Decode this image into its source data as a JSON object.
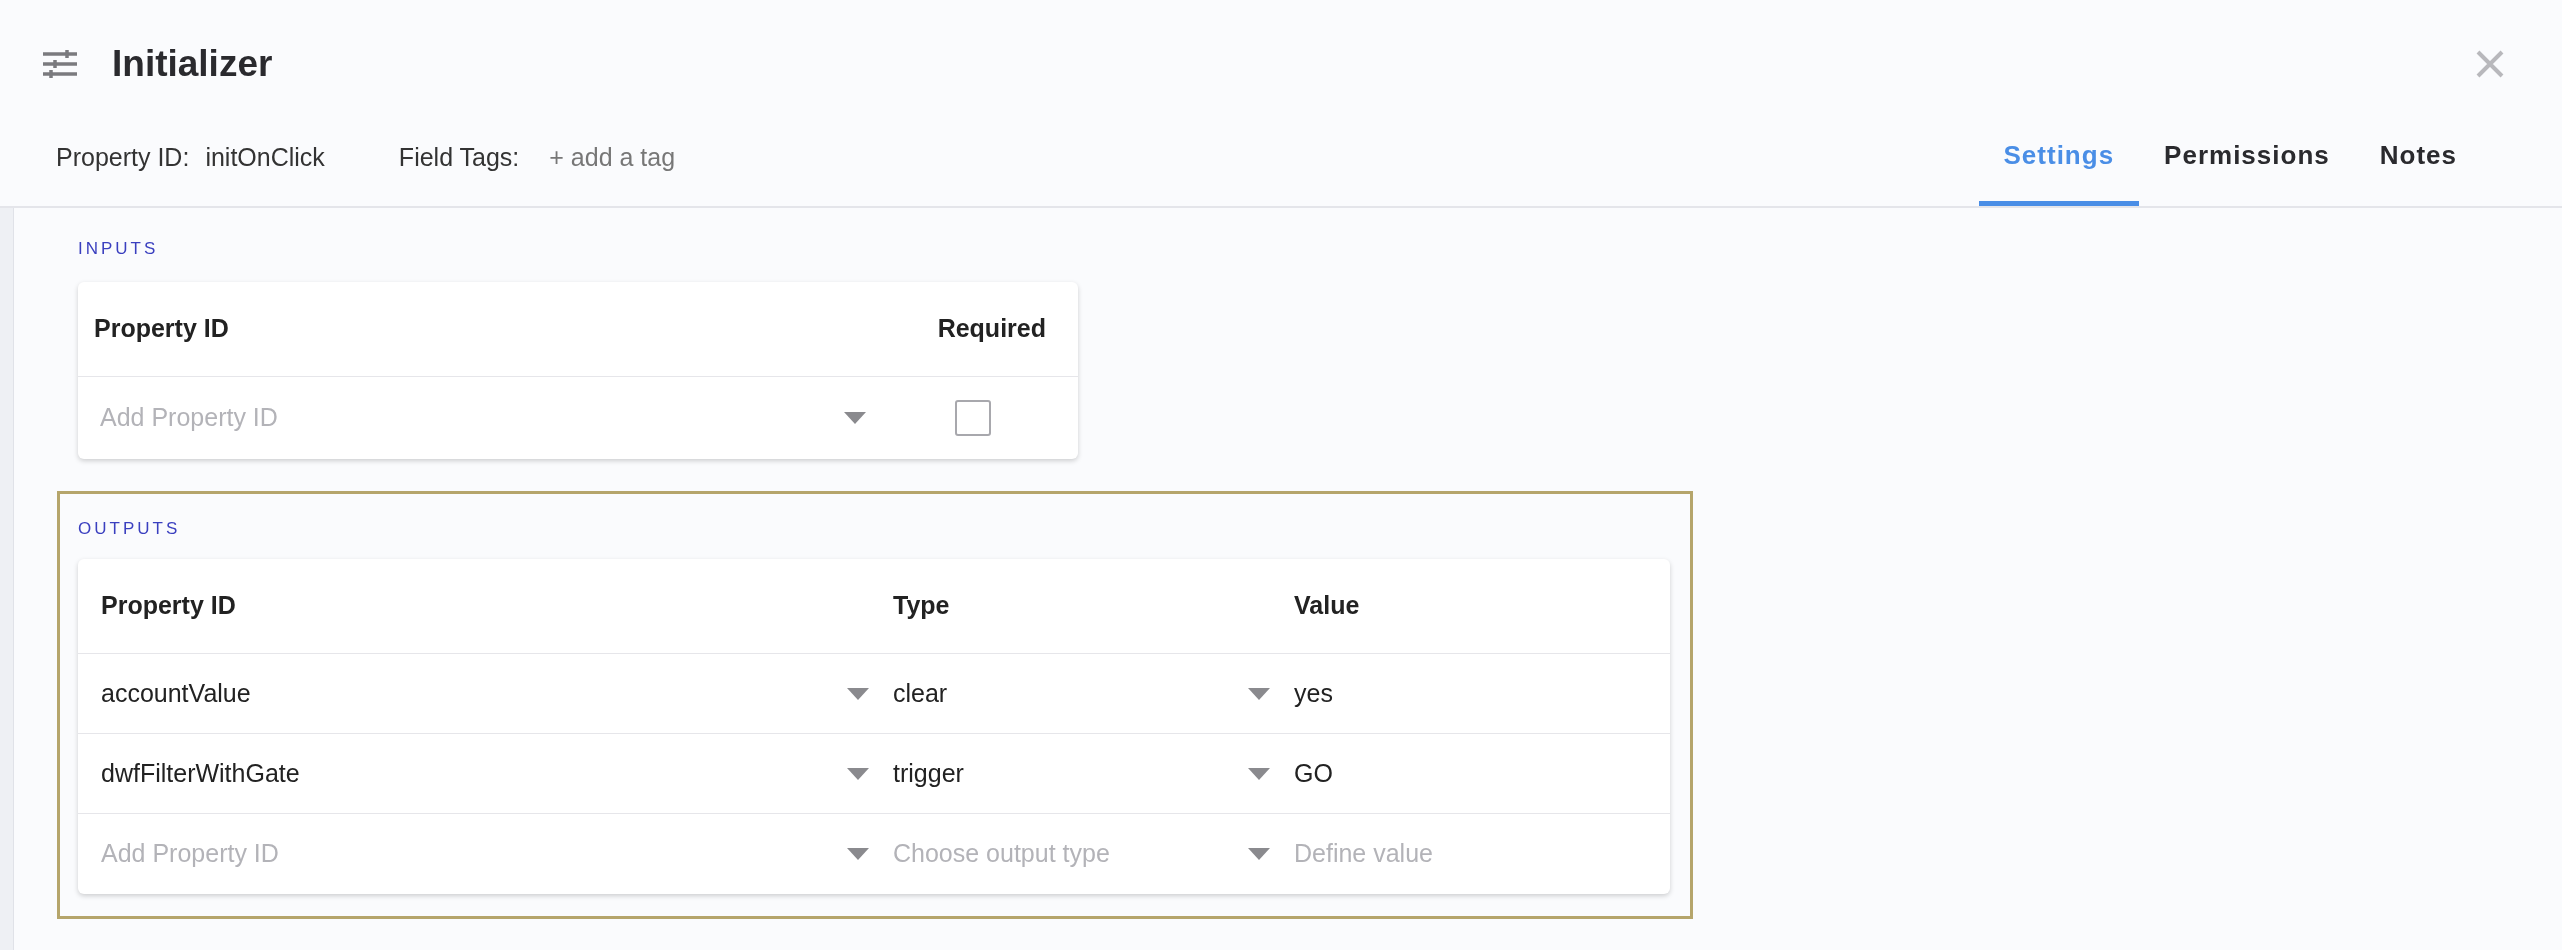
{
  "header": {
    "title": "Initializer",
    "property_id_label": "Property ID:",
    "property_id_value": "initOnClick",
    "field_tags_label": "Field Tags:",
    "add_tag": "+ add a tag"
  },
  "tabs": [
    {
      "label": "Settings",
      "selected": true
    },
    {
      "label": "Permissions",
      "selected": false
    },
    {
      "label": "Notes",
      "selected": false
    }
  ],
  "inputs": {
    "label": "INPUTS",
    "columns": [
      "Property ID",
      "Required"
    ],
    "rows": [
      {
        "property_id": {
          "placeholder": "Add Property ID"
        },
        "required": {
          "checked": false
        }
      }
    ]
  },
  "outputs": {
    "label": "OUTPUTS",
    "highlighted": true,
    "columns": [
      "Property ID",
      "Type",
      "Value"
    ],
    "rows": [
      {
        "property_id": {
          "value": "accountValue"
        },
        "type": {
          "value": "clear"
        },
        "value": {
          "value": "yes"
        }
      },
      {
        "property_id": {
          "value": "dwfFilterWithGate"
        },
        "type": {
          "value": "trigger"
        },
        "value": {
          "value": "GO"
        }
      },
      {
        "property_id": {
          "placeholder": "Add Property ID"
        },
        "type": {
          "placeholder": "Choose output type"
        },
        "value": {
          "placeholder": "Define value"
        }
      }
    ]
  }
}
